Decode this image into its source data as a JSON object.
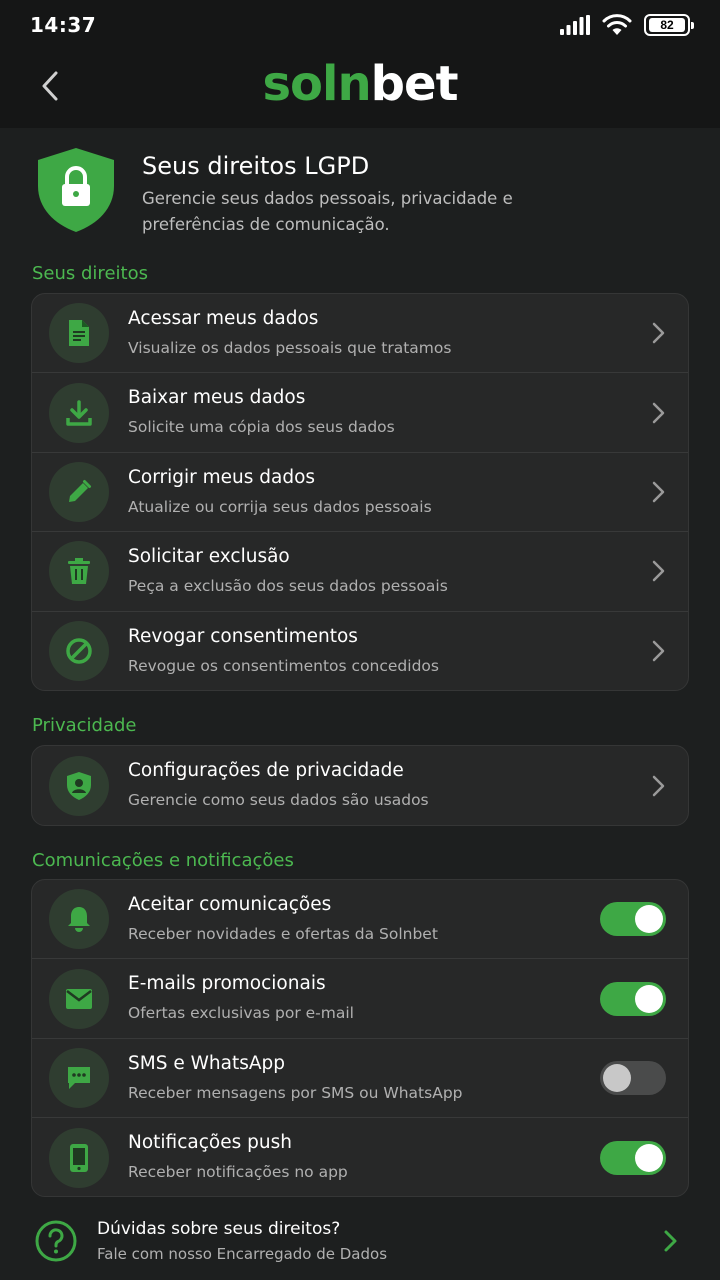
{
  "status_bar": {
    "time": "14:37",
    "battery": "82"
  },
  "app": {
    "logo_part1": "soln",
    "logo_part2": "bet"
  },
  "header": {
    "title": "Seus direitos LGPD",
    "description": "Gerencie seus dados pessoais, privacidade e preferências de comunicação."
  },
  "sections": {
    "rights": {
      "title": "Seus direitos",
      "items": [
        {
          "title": "Acessar meus dados",
          "subtitle": "Visualize os dados pessoais que tratamos"
        },
        {
          "title": "Baixar meus dados",
          "subtitle": "Solicite uma cópia dos seus dados"
        },
        {
          "title": "Corrigir meus dados",
          "subtitle": "Atualize ou corrija seus dados pessoais"
        },
        {
          "title": "Solicitar exclusão",
          "subtitle": "Peça a exclusão dos seus dados pessoais"
        },
        {
          "title": "Revogar consentimentos",
          "subtitle": "Revogue os consentimentos concedidos"
        }
      ]
    },
    "privacy": {
      "title": "Privacidade",
      "items": [
        {
          "title": "Configurações de privacidade",
          "subtitle": "Gerencie como seus dados são usados"
        }
      ]
    },
    "communications": {
      "title": "Comunicações e notificações",
      "items": [
        {
          "title": "Aceitar comunicações",
          "subtitle": "Receber novidades e ofertas da Solnbet",
          "enabled": true
        },
        {
          "title": "E-mails promocionais",
          "subtitle": "Ofertas exclusivas por e-mail",
          "enabled": true
        },
        {
          "title": "SMS e WhatsApp",
          "subtitle": "Receber mensagens por SMS ou WhatsApp",
          "enabled": false
        },
        {
          "title": "Notificações push",
          "subtitle": "Receber notificações no app",
          "enabled": true
        }
      ]
    }
  },
  "footer": {
    "title": "Dúvidas sobre seus direitos?",
    "subtitle": "Fale com nosso Encarregado de Dados"
  },
  "colors": {
    "accent": "#3ea845",
    "background": "#1d1f1f",
    "card": "#272828"
  }
}
